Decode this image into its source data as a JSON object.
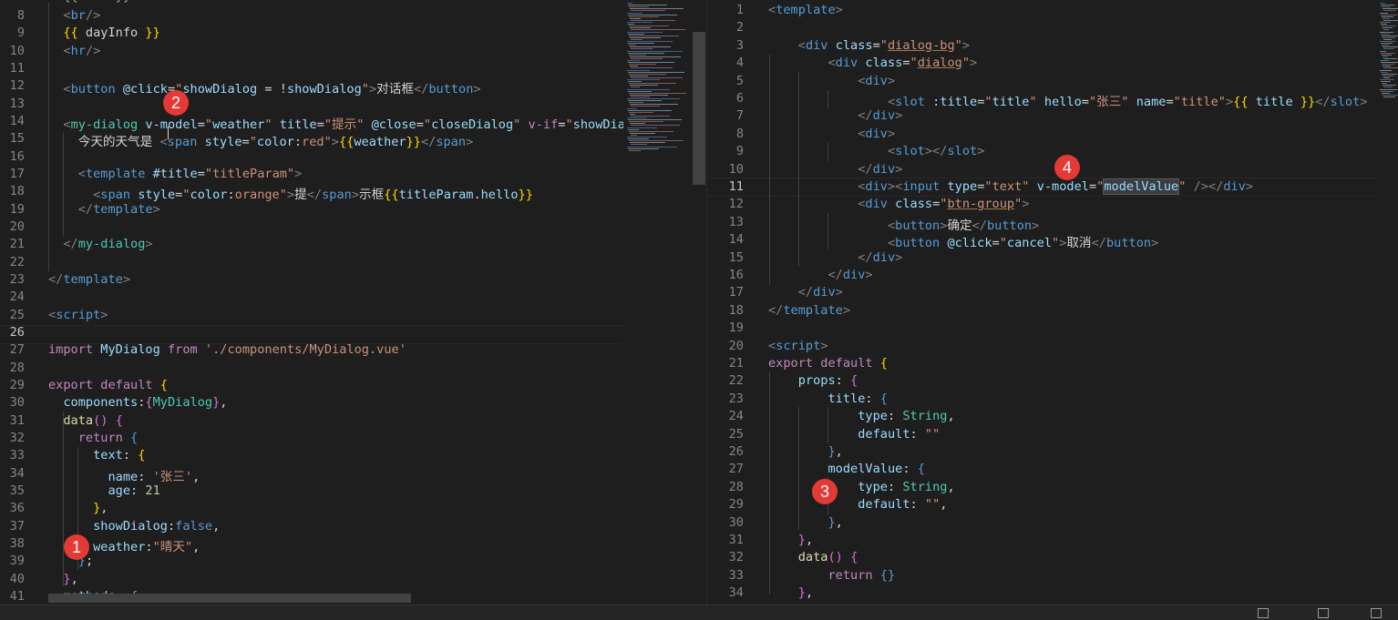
{
  "left_editor": {
    "lines": [
      {
        "n": "8",
        "html": "  <span class='t'>&lt;</span><span class='tag'>br</span><span class='t'>/&gt;</span>"
      },
      {
        "n": "9",
        "html": "  <span class='br'>{{</span> dayInfo <span class='br'>}}</span>"
      },
      {
        "n": "10",
        "html": "  <span class='t'>&lt;</span><span class='tag'>hr</span><span class='t'>/&gt;</span>"
      },
      {
        "n": "11",
        "html": ""
      },
      {
        "n": "12",
        "html": "  <span class='t'>&lt;</span><span class='tag'>button</span> <span class='at'>@click</span><span class='pl'>=</span><span class='st'>\"</span><span class='at'>showDialog</span> <span class='pl'>= !</span><span class='at'>showDialog</span><span class='st'>\"</span><span class='t'>&gt;</span>对话框<span class='t'>&lt;/</span><span class='tag'>button</span><span class='t'>&gt;</span>"
      },
      {
        "n": "13",
        "html": ""
      },
      {
        "n": "14",
        "html": "  <span class='t'>&lt;</span><span class='ty'>my-dialog</span> <span class='at'>v-model</span><span class='pl'>=</span><span class='st'>\"</span><span class='at'>weather</span><span class='st'>\"</span> <span class='at'>title</span><span class='pl'>=</span><span class='st'>\"提示\"</span> <span class='at'>@close</span><span class='pl'>=</span><span class='st'>\"</span><span class='at'>closeDialog</span><span class='st'>\"</span> <span class='kw'>v-if</span><span class='pl'>=</span><span class='st'>\"</span><span class='at'>showDialog</span>"
      },
      {
        "n": "15",
        "html": "    今天的天气是 <span class='t'>&lt;</span><span class='tag'>span</span> <span class='at'>style</span><span class='pl'>=</span><span class='st'>\"</span><span class='at'>color</span><span class='pl'>:</span><span class='st'>red\"</span><span class='t'>&gt;</span><span class='br'>{{</span><span class='at'>weather</span><span class='br'>}}</span><span class='t'>&lt;/</span><span class='tag'>span</span><span class='t'>&gt;</span>"
      },
      {
        "n": "16",
        "html": ""
      },
      {
        "n": "17",
        "html": "    <span class='t'>&lt;</span><span class='tag'>template</span> <span class='at'>#title</span><span class='pl'>=</span><span class='st'>\"titleParam\"</span><span class='t'>&gt;</span>"
      },
      {
        "n": "18",
        "html": "      <span class='t'>&lt;</span><span class='tag'>span</span> <span class='at'>style</span><span class='pl'>=</span><span class='st'>\"</span><span class='at'>color</span><span class='pl'>:</span><span class='st'>orange\"</span><span class='t'>&gt;</span>提<span class='t'>&lt;/</span><span class='tag'>span</span><span class='t'>&gt;</span>示框<span class='br'>{{</span><span class='at'>titleParam</span><span class='pl'>.</span><span class='at'>hello</span><span class='br'>}}</span>"
      },
      {
        "n": "19",
        "html": "    <span class='t'>&lt;/</span><span class='tag'>template</span><span class='t'>&gt;</span>"
      },
      {
        "n": "20",
        "html": ""
      },
      {
        "n": "21",
        "html": "  <span class='t'>&lt;/</span><span class='ty'>my-dialog</span><span class='t'>&gt;</span>"
      },
      {
        "n": "22",
        "html": ""
      },
      {
        "n": "23",
        "html": "<span class='t'>&lt;/</span><span class='tag'>template</span><span class='t'>&gt;</span>"
      },
      {
        "n": "24",
        "html": ""
      },
      {
        "n": "25",
        "html": "<span class='t'>&lt;</span><span class='tag'>script</span><span class='t'>&gt;</span>"
      },
      {
        "n": "26",
        "html": ""
      },
      {
        "n": "27",
        "html": "<span class='kw'>import</span> <span class='at'>MyDialog</span> <span class='kw'>from</span> <span class='st'>'./components/MyDialog.vue'</span>"
      },
      {
        "n": "28",
        "html": ""
      },
      {
        "n": "29",
        "html": "<span class='kw'>export</span> <span class='kw'>default</span> <span class='br'>{</span>"
      },
      {
        "n": "30",
        "html": "  <span class='at'>components</span><span class='pl'>:</span><span class='pk'>{</span><span class='ty'>MyDialog</span><span class='pk'>}</span><span class='pl'>,</span>"
      },
      {
        "n": "31",
        "html": "  <span class='fn'>data</span><span class='pk'>()</span> <span class='pk'>{</span>"
      },
      {
        "n": "32",
        "html": "    <span class='kw'>return</span> <span class='bl'>{</span>"
      },
      {
        "n": "33",
        "html": "      <span class='at'>text</span><span class='pl'>:</span> <span class='br'>{</span>"
      },
      {
        "n": "34",
        "html": "        <span class='at'>name</span><span class='pl'>:</span> <span class='st'>'张三'</span><span class='pl'>,</span>"
      },
      {
        "n": "35",
        "html": "        <span class='at'>age</span><span class='pl'>:</span> <span class='nm'>21</span>"
      },
      {
        "n": "36",
        "html": "      <span class='br'>}</span><span class='pl'>,</span>"
      },
      {
        "n": "37",
        "html": "      <span class='at'>showDialog</span><span class='pl'>:</span><span class='bl'>false</span><span class='pl'>,</span>"
      },
      {
        "n": "38",
        "html": "      <span class='at'>weather</span><span class='pl'>:</span><span class='st'>\"晴天\"</span><span class='pl'>,</span>"
      },
      {
        "n": "39",
        "html": "    <span class='bl'>}</span><span class='pl'>;</span>"
      },
      {
        "n": "40",
        "html": "  <span class='pk'>}</span><span class='pl'>,</span>"
      },
      {
        "n": "41",
        "html": "  <span class='at'>methods</span><span class='pl'>:</span> <span class='pk'>{</span>"
      }
    ]
  },
  "right_editor": {
    "lines": [
      {
        "n": "1",
        "html": "<span class='t'>&lt;</span><span class='tag'>template</span><span class='t'>&gt;</span>"
      },
      {
        "n": "2",
        "html": ""
      },
      {
        "n": "3",
        "html": "    <span class='t'>&lt;</span><span class='tag'>div</span> <span class='at'>class</span><span class='pl'>=</span><span class='st'>\"<span class='ul'>dialog-bg</span>\"</span><span class='t'>&gt;</span>"
      },
      {
        "n": "4",
        "html": "        <span class='t'>&lt;</span><span class='tag'>div</span> <span class='at'>class</span><span class='pl'>=</span><span class='st'>\"<span class='ul'>dialog</span>\"</span><span class='t'>&gt;</span>"
      },
      {
        "n": "5",
        "html": "            <span class='t'>&lt;</span><span class='tag'>div</span><span class='t'>&gt;</span>"
      },
      {
        "n": "6",
        "html": "                <span class='t'>&lt;</span><span class='tag'>slot</span> <span class='at'>:title</span><span class='pl'>=</span><span class='st'>\"</span><span class='at'>title</span><span class='st'>\"</span> <span class='at'>hello</span><span class='pl'>=</span><span class='st'>\"张三\"</span> <span class='at'>name</span><span class='pl'>=</span><span class='st'>\"title\"</span><span class='t'>&gt;</span><span class='br'>{{</span> <span class='at'>title</span> <span class='br'>}}</span><span class='t'>&lt;/</span><span class='tag'>slot</span><span class='t'>&gt;</span>"
      },
      {
        "n": "7",
        "html": "            <span class='t'>&lt;/</span><span class='tag'>div</span><span class='t'>&gt;</span>"
      },
      {
        "n": "8",
        "html": "            <span class='t'>&lt;</span><span class='tag'>div</span><span class='t'>&gt;</span>"
      },
      {
        "n": "9",
        "html": "                <span class='t'>&lt;</span><span class='tag'>slot</span><span class='t'>&gt;&lt;/</span><span class='tag'>slot</span><span class='t'>&gt;</span>"
      },
      {
        "n": "10",
        "html": "            <span class='t'>&lt;/</span><span class='tag'>div</span><span class='t'>&gt;</span>"
      },
      {
        "n": "11",
        "html": "            <span class='t'>&lt;</span><span class='tag'>div</span><span class='t'>&gt;&lt;</span><span class='tag'>input</span> <span class='at'>type</span><span class='pl'>=</span><span class='st'>\"text\"</span> <span class='at'>v-model</span><span class='pl'>=</span><span class='st'>\"</span><span class='at sel'>modelValue</span><span class='st'>\"</span> <span class='t'>/&gt;&lt;/</span><span class='tag'>div</span><span class='t'>&gt;</span>"
      },
      {
        "n": "12",
        "html": "            <span class='t'>&lt;</span><span class='tag'>div</span> <span class='at'>class</span><span class='pl'>=</span><span class='st'>\"<span class='ul'>btn-group</span>\"</span><span class='t'>&gt;</span>"
      },
      {
        "n": "13",
        "html": "                <span class='t'>&lt;</span><span class='tag'>button</span><span class='t'>&gt;</span>确定<span class='t'>&lt;/</span><span class='tag'>button</span><span class='t'>&gt;</span>"
      },
      {
        "n": "14",
        "html": "                <span class='t'>&lt;</span><span class='tag'>button</span> <span class='at'>@click</span><span class='pl'>=</span><span class='st'>\"</span><span class='at'>cancel</span><span class='st'>\"</span><span class='t'>&gt;</span>取消<span class='t'>&lt;/</span><span class='tag'>button</span><span class='t'>&gt;</span>"
      },
      {
        "n": "15",
        "html": "            <span class='t'>&lt;/</span><span class='tag'>div</span><span class='t'>&gt;</span>"
      },
      {
        "n": "16",
        "html": "        <span class='t'>&lt;/</span><span class='tag'>div</span><span class='t'>&gt;</span>"
      },
      {
        "n": "17",
        "html": "    <span class='t'>&lt;/</span><span class='tag'>div</span><span class='t'>&gt;</span>"
      },
      {
        "n": "18",
        "html": "<span class='t'>&lt;/</span><span class='tag'>template</span><span class='t'>&gt;</span>"
      },
      {
        "n": "19",
        "html": ""
      },
      {
        "n": "20",
        "html": "<span class='t'>&lt;</span><span class='tag'>script</span><span class='t'>&gt;</span>"
      },
      {
        "n": "21",
        "html": "<span class='kw'>export</span> <span class='kw'>default</span> <span class='br'>{</span>"
      },
      {
        "n": "22",
        "html": "    <span class='at'>props</span><span class='pl'>:</span> <span class='pk'>{</span>"
      },
      {
        "n": "23",
        "html": "        <span class='at'>title</span><span class='pl'>:</span> <span class='bl'>{</span>"
      },
      {
        "n": "24",
        "html": "            <span class='at'>type</span><span class='pl'>:</span> <span class='ty'>String</span><span class='pl'>,</span>"
      },
      {
        "n": "25",
        "html": "            <span class='at'>default</span><span class='pl'>:</span> <span class='st'>\"\"</span>"
      },
      {
        "n": "26",
        "html": "        <span class='bl'>}</span><span class='pl'>,</span>"
      },
      {
        "n": "27",
        "html": "        <span class='at'>modelValue</span><span class='pl'>:</span> <span class='bl'>{</span>"
      },
      {
        "n": "28",
        "html": "            <span class='at'>type</span><span class='pl'>:</span> <span class='ty'>String</span><span class='pl'>,</span>"
      },
      {
        "n": "29",
        "html": "            <span class='at'>default</span><span class='pl'>:</span> <span class='st'>\"\"</span><span class='pl'>,</span>"
      },
      {
        "n": "30",
        "html": "        <span class='bl'>}</span><span class='pl'>,</span>"
      },
      {
        "n": "31",
        "html": "    <span class='pk'>}</span><span class='pl'>,</span>"
      },
      {
        "n": "32",
        "html": "    <span class='fn'>data</span><span class='pk'>()</span> <span class='pk'>{</span>"
      },
      {
        "n": "33",
        "html": "        <span class='kw'>return</span> <span class='bl'>{}</span>"
      },
      {
        "n": "34",
        "html": "    <span class='pk'>}</span><span class='pl'>,</span>"
      }
    ]
  },
  "annotations": [
    "1",
    "2",
    "3",
    "4"
  ],
  "status_bar": {
    "items": []
  }
}
